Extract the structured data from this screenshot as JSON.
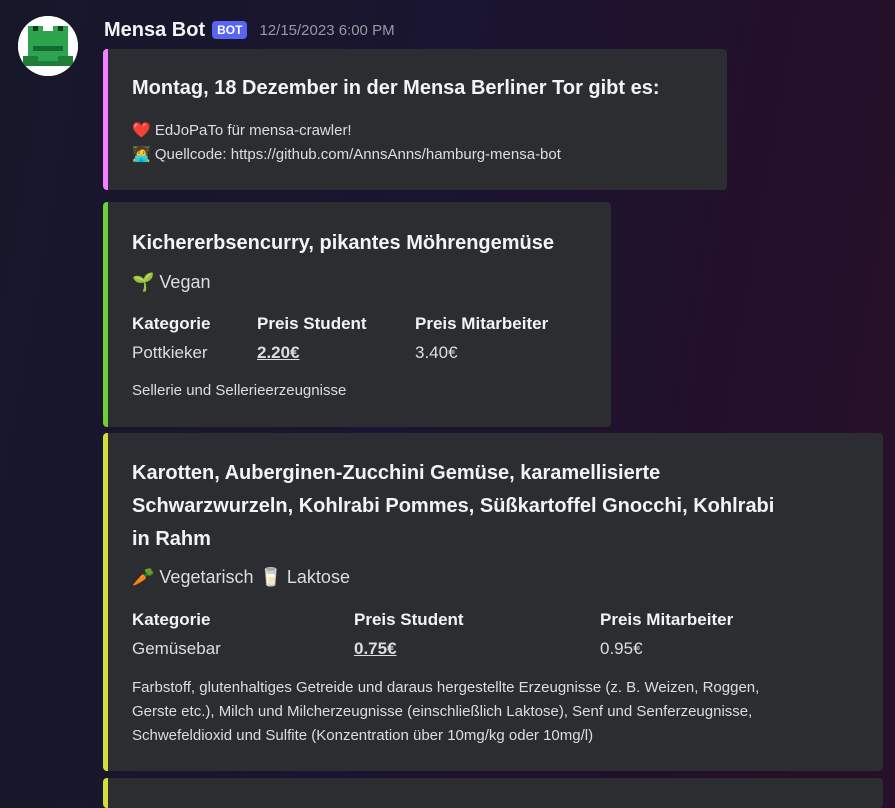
{
  "message": {
    "author": "Mensa Bot",
    "badge": "BOT",
    "timestamp": "12/15/2023 6:00 PM"
  },
  "intro": {
    "title": "Montag, 18 Dezember in der Mensa Berliner Tor gibt es:",
    "line1_emoji": "❤️",
    "line1": "EdJoPaTo für mensa-crawler!",
    "line2_emoji": "🧑‍💻",
    "line2": "Quellcode: https://github.com/AnnsAnns/hamburg-mensa-bot",
    "accent": "#f47fff"
  },
  "meals": [
    {
      "title": "Kichererbsencurry, pikantes Möhrengemüse",
      "tags": [
        {
          "emoji": "🌱",
          "label": "Vegan"
        }
      ],
      "field_names": [
        "Kategorie",
        "Preis Student",
        "Preis Mitarbeiter"
      ],
      "category": "Pottkieker",
      "price_student": "2.20€",
      "price_employee": "3.40€",
      "allergens": "Sellerie und Sellerieerzeugnisse",
      "accent": "#6fcf3a"
    },
    {
      "title_lines": [
        "Karotten, Auberginen-Zucchini Gemüse, karamellisierte",
        "Schwarzwurzeln, Kohlrabi Pommes, Süßkartoffel Gnocchi, Kohlrabi",
        "in Rahm"
      ],
      "tags": [
        {
          "emoji": "🥕",
          "label": "Vegetarisch"
        },
        {
          "emoji": "🥛",
          "label": "Laktose"
        }
      ],
      "field_names": [
        "Kategorie",
        "Preis Student",
        "Preis Mitarbeiter"
      ],
      "category": "Gemüsebar",
      "price_student": "0.75€",
      "price_employee": "0.95€",
      "allergen_lines": [
        "Farbstoff, glutenhaltiges Getreide und daraus hergestellte Erzeugnisse (z. B. Weizen, Roggen,",
        "Gerste etc.), Milch und Milcherzeugnisse (einschließlich Laktose), Senf und Senferzeugnisse,",
        "Schwefeldioxid und Sulfite (Konzentration über 10mg/kg oder 10mg/l)"
      ],
      "accent": "#d4dc3a"
    }
  ],
  "next_embed": {
    "accent": "#d4dc3a"
  }
}
